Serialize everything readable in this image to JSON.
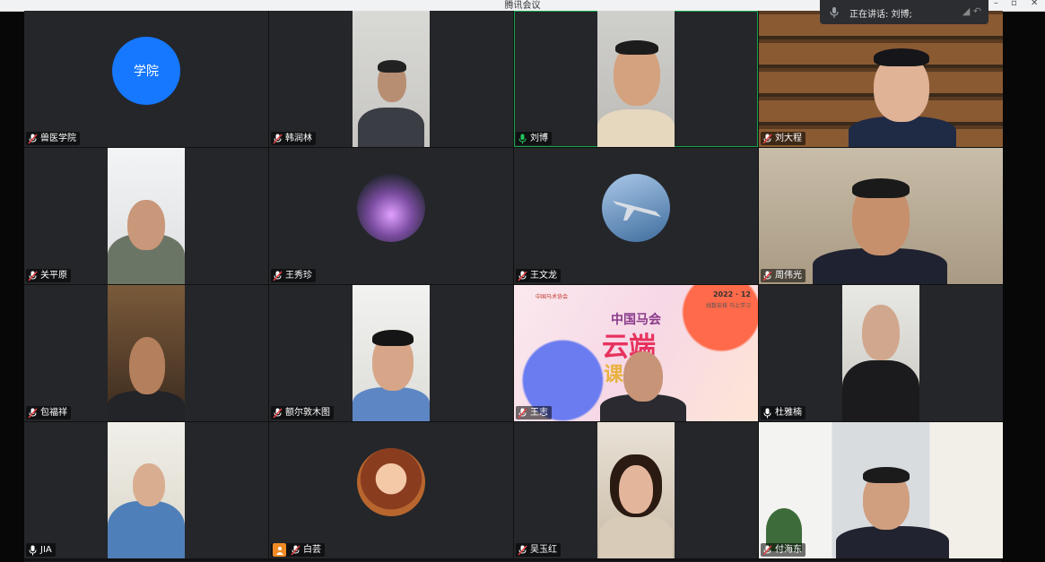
{
  "window": {
    "title": "腾讯会议"
  },
  "speaking": {
    "text": "正在讲话: 刘博;"
  },
  "participants": [
    {
      "name": "兽医学院",
      "initials": "学院",
      "mic": "muted"
    },
    {
      "name": "韩润林",
      "mic": "muted"
    },
    {
      "name": "刘博",
      "mic": "active"
    },
    {
      "name": "刘大程",
      "mic": "muted"
    },
    {
      "name": "关平原",
      "mic": "muted"
    },
    {
      "name": "王秀珍",
      "mic": "muted"
    },
    {
      "name": "王文龙",
      "mic": "muted"
    },
    {
      "name": "周伟光",
      "mic": "muted"
    },
    {
      "name": "包福祥",
      "mic": "muted"
    },
    {
      "name": "额尔敦木图",
      "mic": "muted"
    },
    {
      "name": "王志",
      "mic": "muted"
    },
    {
      "name": "杜雅楠",
      "mic": "on"
    },
    {
      "name": "JIA",
      "mic": "on"
    },
    {
      "name": "白芸",
      "mic": "muted",
      "badge": "orange"
    },
    {
      "name": "吴玉红",
      "mic": "muted"
    },
    {
      "name": "付海东",
      "mic": "muted"
    }
  ],
  "shared_slide": {
    "org": "中国马术协会",
    "date": "2022 · 12",
    "slogan": "线数安排 马上学习",
    "title_line1": "中国马会",
    "title_line2": "云端",
    "title_line3": "课"
  },
  "colors": {
    "accent": "#1677ff",
    "active_border": "#16a34a",
    "muted_mic": "#e04040",
    "tile_bg": "#24262a"
  }
}
